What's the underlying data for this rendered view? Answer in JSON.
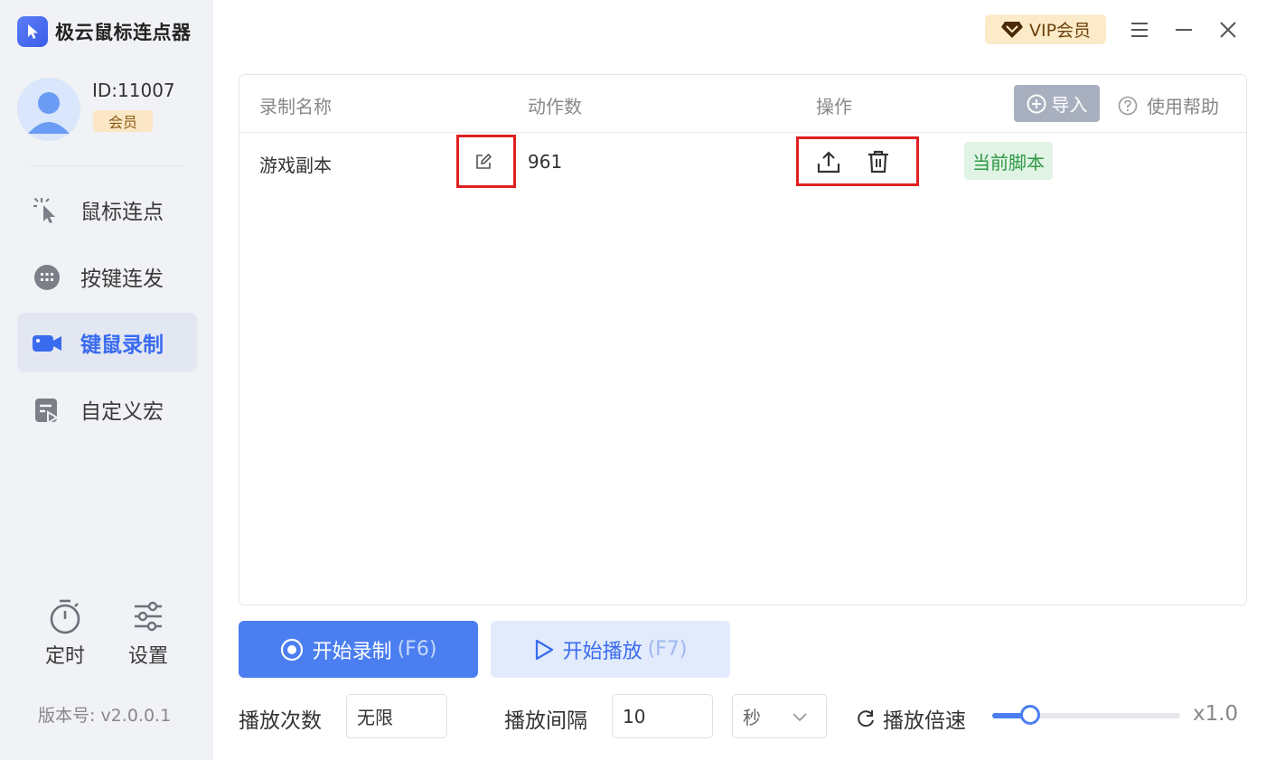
{
  "app": {
    "title": "极云鼠标连点器"
  },
  "user": {
    "id_text": "ID:11007",
    "member_label": "会员"
  },
  "sidebar": {
    "items": [
      {
        "label": "鼠标连点",
        "icon": "cursor-click-icon",
        "active": false
      },
      {
        "label": "按键连发",
        "icon": "keyboard-icon",
        "active": false
      },
      {
        "label": "键鼠录制",
        "icon": "video-camera-icon",
        "active": true
      },
      {
        "label": "自定义宏",
        "icon": "macro-icon",
        "active": false
      }
    ],
    "tools": [
      {
        "label": "定时",
        "icon": "timer-icon"
      },
      {
        "label": "设置",
        "icon": "sliders-icon"
      }
    ],
    "version": "版本号: v2.0.0.1"
  },
  "topbar": {
    "vip_label": "VIP会员"
  },
  "table": {
    "headers": {
      "name": "录制名称",
      "actions_count": "动作数",
      "operation": "操作"
    },
    "import_label": "导入",
    "help_label": "使用帮助",
    "rows": [
      {
        "name": "游戏副本",
        "actions": "961",
        "status": "当前脚本"
      }
    ]
  },
  "buttons": {
    "record": {
      "label": "开始录制",
      "hotkey": "(F6)"
    },
    "play": {
      "label": "开始播放",
      "hotkey": "(F7)"
    }
  },
  "controls": {
    "play_count_label": "播放次数",
    "play_count_value": "无限",
    "interval_label": "播放间隔",
    "interval_value": "10",
    "interval_unit": "秒",
    "speed_label": "播放倍速",
    "speed_value": "x1.0",
    "speed_fraction": 0.2
  },
  "colors": {
    "accent": "#4b7ef0",
    "highlight": "#e02020",
    "success": "#2e9a45",
    "vip_bg": "#fcebc9"
  }
}
